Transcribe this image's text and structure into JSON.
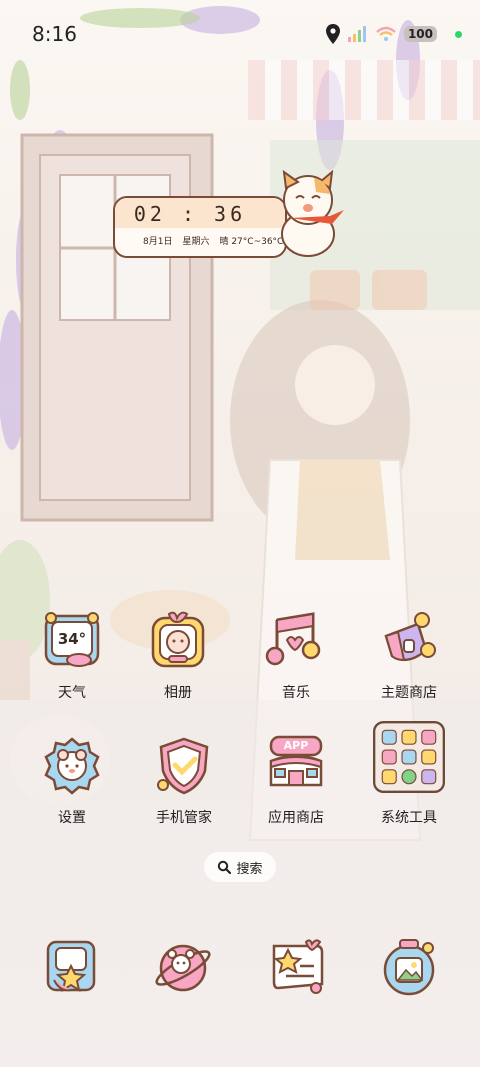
{
  "status_bar": {
    "time": "8:16",
    "battery": "100"
  },
  "clock_widget": {
    "time": "02 : 36",
    "date": "8月1日",
    "weekday": "星期六",
    "weather": "晴 27°C~36°C"
  },
  "apps": [
    {
      "label": "天气",
      "icon": "weather-icon",
      "badge": "34°"
    },
    {
      "label": "相册",
      "icon": "gallery-icon"
    },
    {
      "label": "音乐",
      "icon": "music-icon"
    },
    {
      "label": "主题商店",
      "icon": "theme-store-icon"
    },
    {
      "label": "设置",
      "icon": "settings-icon"
    },
    {
      "label": "手机管家",
      "icon": "phone-manager-icon"
    },
    {
      "label": "应用商店",
      "icon": "app-store-icon",
      "badge": "APP"
    },
    {
      "label": "系统工具",
      "icon": "system-tools-folder-icon"
    }
  ],
  "search": {
    "label": "搜索"
  },
  "dock": [
    {
      "icon": "phone-icon"
    },
    {
      "icon": "messages-icon"
    },
    {
      "icon": "browser-icon"
    },
    {
      "icon": "camera-icon"
    }
  ],
  "colors": {
    "accent": "#fce5cf",
    "outline": "#7a4b36",
    "pink": "#f7a6c4",
    "blue": "#a9d7f0",
    "yellow": "#ffd970"
  }
}
